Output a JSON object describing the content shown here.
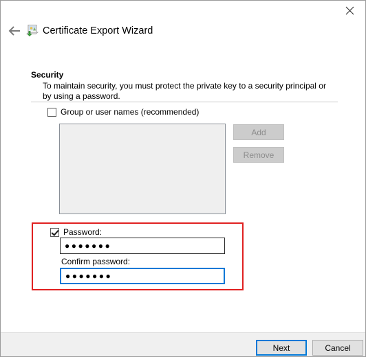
{
  "window": {
    "title": "Certificate Export Wizard",
    "close_icon": "close-icon",
    "back_icon": "back-arrow-icon",
    "wizard_icon": "certificate-export-icon"
  },
  "page": {
    "heading": "Security",
    "description": "To maintain security, you must protect the private key to a security principal or by using a password."
  },
  "group_names": {
    "checkbox_label": "Group or user names (recommended)",
    "checked": false,
    "list_items": [],
    "add_label": "Add",
    "add_enabled": false,
    "remove_label": "Remove",
    "remove_enabled": false
  },
  "password": {
    "checkbox_label": "Password:",
    "checked": true,
    "value": "●●●●●●●",
    "confirm_label": "Confirm password:",
    "confirm_value": "●●●●●●●",
    "confirm_focused": true,
    "highlight_color": "#e02020"
  },
  "footer": {
    "next_label": "Next",
    "cancel_label": "Cancel",
    "default_button_color": "#0078d7"
  }
}
